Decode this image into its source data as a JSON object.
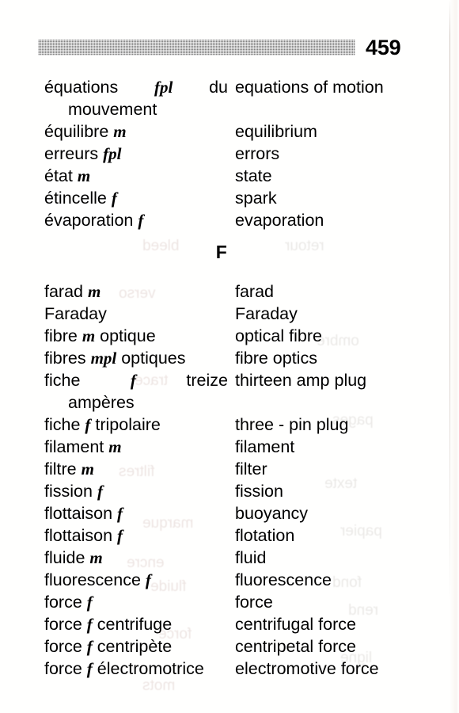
{
  "page": {
    "number": "459",
    "section_letter": "F",
    "paper_color": "#ffffff",
    "ink_color": "#000000",
    "rule_color": "#8d8d8d"
  },
  "entries_before_letter": [
    {
      "fr_line1_parts": [
        "équations",
        "fpl",
        "du"
      ],
      "fr_line2": "mouvement",
      "fr_plain": "équations fpl du mouvement",
      "en": "equations of motion",
      "justified": true
    },
    {
      "fr_head": "équilibre",
      "fr_gender": "m",
      "fr_tail": "",
      "en": "equilibrium"
    },
    {
      "fr_head": "erreurs",
      "fr_gender": "fpl",
      "fr_tail": "",
      "en": "errors"
    },
    {
      "fr_head": "état",
      "fr_gender": "m",
      "fr_tail": "",
      "en": "state"
    },
    {
      "fr_head": "étincelle",
      "fr_gender": "f",
      "fr_tail": "",
      "en": "spark"
    },
    {
      "fr_head": "évaporation",
      "fr_gender": "f",
      "fr_tail": "",
      "en": "evaporation"
    }
  ],
  "entries_after_letter": [
    {
      "fr_head": "farad",
      "fr_gender": "m",
      "fr_tail": "",
      "en": "farad"
    },
    {
      "fr_head": "Faraday",
      "fr_gender": "",
      "fr_tail": "",
      "en": "Faraday"
    },
    {
      "fr_head": "fibre",
      "fr_gender": "m",
      "fr_tail": "optique",
      "en": "optical fibre"
    },
    {
      "fr_head": "fibres",
      "fr_gender": "mpl",
      "fr_tail": "optiques",
      "en": "fibre optics"
    },
    {
      "fr_line1_parts": [
        "fiche",
        "f",
        "treize"
      ],
      "fr_line2": "ampères",
      "fr_plain": "fiche f treize ampères",
      "en": "thirteen amp plug",
      "justified": true
    },
    {
      "fr_head": "fiche",
      "fr_gender": "f",
      "fr_tail": "tripolaire",
      "en": "three - pin plug"
    },
    {
      "fr_head": "filament",
      "fr_gender": "m",
      "fr_tail": "",
      "en": "filament"
    },
    {
      "fr_head": "filtre",
      "fr_gender": "m",
      "fr_tail": "",
      "en": "filter"
    },
    {
      "fr_head": "fission",
      "fr_gender": "f",
      "fr_tail": "",
      "en": "fission"
    },
    {
      "fr_head": "flottaison",
      "fr_gender": "f",
      "fr_tail": "",
      "en": "buoyancy"
    },
    {
      "fr_head": "flottaison",
      "fr_gender": "f",
      "fr_tail": "",
      "en": "flotation"
    },
    {
      "fr_head": "fluide",
      "fr_gender": "m",
      "fr_tail": "",
      "en": "fluid"
    },
    {
      "fr_head": "fluorescence",
      "fr_gender": "f",
      "fr_tail": "",
      "en": "fluorescence"
    },
    {
      "fr_head": "force",
      "fr_gender": "f",
      "fr_tail": "",
      "en": "force"
    },
    {
      "fr_head": "force",
      "fr_gender": "f",
      "fr_tail": "centrifuge",
      "en": "centrifugal force"
    },
    {
      "fr_head": "force",
      "fr_gender": "f",
      "fr_tail": "centripète",
      "en": "centripetal force"
    },
    {
      "fr_head": "force",
      "fr_gender": "f",
      "fr_tail": "électromotrice",
      "en": "electromotive force"
    }
  ]
}
